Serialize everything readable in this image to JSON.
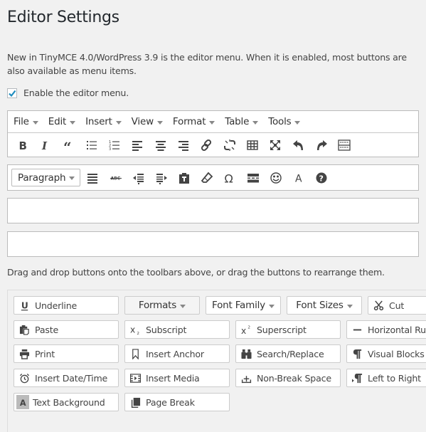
{
  "page": {
    "title": "Editor Settings",
    "description": "New in TinyMCE 4.0/WordPress 3.9 is the editor menu. When it is enabled, most buttons are also available as menu items.",
    "enable_menu": {
      "label": "Enable the editor menu.",
      "checked": true
    },
    "drag_hint": "Drag and drop buttons onto the toolbars above, or drag the buttons to rearrange them."
  },
  "menubar": {
    "items": [
      {
        "label": "File"
      },
      {
        "label": "Edit"
      },
      {
        "label": "Insert"
      },
      {
        "label": "View"
      },
      {
        "label": "Format"
      },
      {
        "label": "Table"
      },
      {
        "label": "Tools"
      }
    ]
  },
  "toolbar1": {
    "icons": [
      "bold",
      "italic",
      "blockquote",
      "bullet-list",
      "numbered-list",
      "align-left",
      "align-center",
      "align-right",
      "link",
      "unlink",
      "table",
      "fullscreen",
      "undo",
      "redo",
      "toolbar-toggle"
    ]
  },
  "toolbar2": {
    "format_select": "Paragraph",
    "icons": [
      "justify",
      "strikethrough",
      "outdent",
      "indent",
      "paste-text",
      "clear-formatting",
      "special-character",
      "horizontal-line",
      "emoticons",
      "text-color",
      "help"
    ]
  },
  "available_buttons": [
    {
      "label": "Underline",
      "icon": "underline"
    },
    {
      "label": "Formats",
      "dropdown": true
    },
    {
      "label": "Font Family",
      "dropdown": true
    },
    {
      "label": "Font Sizes",
      "dropdown": true
    },
    {
      "label": "Cut",
      "icon": "cut"
    },
    {
      "label": "Paste",
      "icon": "paste"
    },
    {
      "label": "Subscript",
      "icon": "subscript"
    },
    {
      "label": "Superscript",
      "icon": "superscript"
    },
    {
      "label": "Horizontal Rule",
      "icon": "horizontal-rule"
    },
    {
      "label": "Print",
      "icon": "print"
    },
    {
      "label": "Insert Anchor",
      "icon": "anchor"
    },
    {
      "label": "Search/Replace",
      "icon": "search-replace"
    },
    {
      "label": "Visual Blocks",
      "icon": "visual-blocks"
    },
    {
      "label": "Insert Date/Time",
      "icon": "date-time"
    },
    {
      "label": "Insert Media",
      "icon": "media"
    },
    {
      "label": "Non-Break Space",
      "icon": "nonbreaking"
    },
    {
      "label": "Left to Right",
      "icon": "ltr"
    },
    {
      "label": "Text Background",
      "icon": "text-background"
    },
    {
      "label": "Page Break",
      "icon": "page-break"
    }
  ],
  "colors": {
    "checkmark": "#1e8cbe",
    "border": "#bbbbbb",
    "background": "#f1f1f1"
  }
}
